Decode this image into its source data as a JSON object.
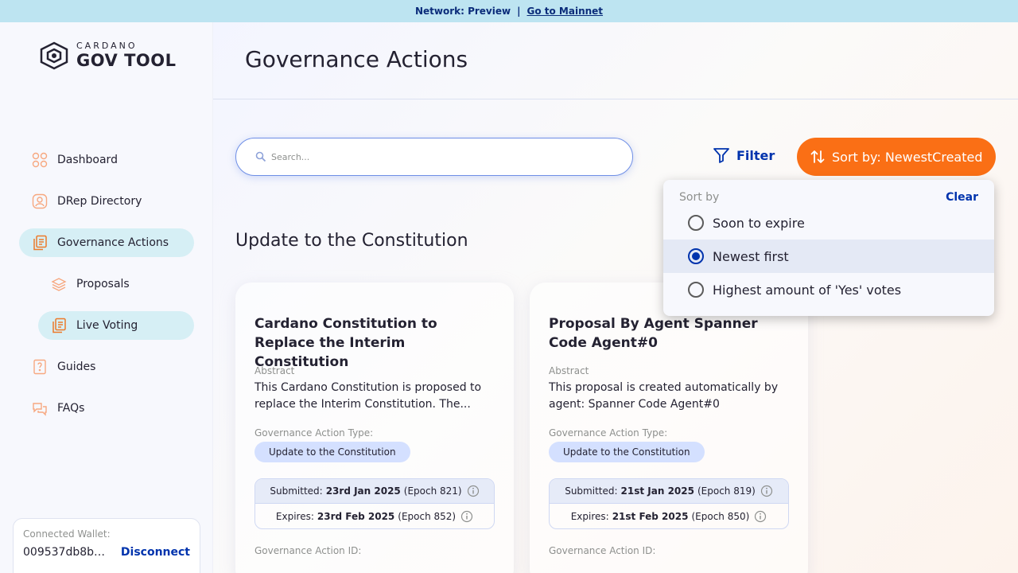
{
  "topbar": {
    "network": "Network: Preview",
    "separator": "|",
    "link": "Go to Mainnet"
  },
  "logo": {
    "small": "CARDANO",
    "big": "GOV TOOL"
  },
  "sidebar": {
    "items": [
      {
        "label": "Dashboard",
        "icon": "dashboard-icon"
      },
      {
        "label": "DRep Directory",
        "icon": "drep-directory-icon"
      },
      {
        "label": "Governance Actions",
        "icon": "governance-actions-icon"
      },
      {
        "label": "Proposals",
        "icon": "proposals-icon"
      },
      {
        "label": "Live Voting",
        "icon": "live-voting-icon"
      },
      {
        "label": "Guides",
        "icon": "guides-icon"
      },
      {
        "label": "FAQs",
        "icon": "faqs-icon"
      }
    ],
    "wallet": {
      "label": "Connected Wallet:",
      "address": "009537db8bb...",
      "disconnect": "Disconnect"
    }
  },
  "header": {
    "title": "Governance Actions"
  },
  "search": {
    "placeholder": "Search..."
  },
  "toolbar": {
    "filter_label": "Filter",
    "sort_label": "Sort by: NewestCreated"
  },
  "section": {
    "title": "Update to the Constitution"
  },
  "cards": [
    {
      "title": "Cardano Constitution to Replace the Interim Constitution",
      "abstract_label": "Abstract",
      "abstract": "This Cardano Constitution is proposed to replace the Interim Constitution. The...",
      "type_label": "Governance Action Type:",
      "type": "Update to the Constitution",
      "submitted_prefix": "Submitted:",
      "submitted_date": "23rd Jan 2025",
      "submitted_epoch": "(Epoch 821)",
      "expires_prefix": "Expires:",
      "expires_date": "23rd Feb 2025",
      "expires_epoch": "(Epoch 852)",
      "id_label": "Governance Action ID:"
    },
    {
      "title": "Proposal By Agent Spanner Code Agent#0",
      "abstract_label": "Abstract",
      "abstract": "This proposal is created automatically by agent: Spanner Code Agent#0",
      "type_label": "Governance Action Type:",
      "type": "Update to the Constitution",
      "submitted_prefix": "Submitted:",
      "submitted_date": "21st Jan 2025",
      "submitted_epoch": "(Epoch 819)",
      "expires_prefix": "Expires:",
      "expires_date": "21st Feb 2025",
      "expires_epoch": "(Epoch 850)",
      "id_label": "Governance Action ID:"
    }
  ],
  "sort_menu": {
    "title": "Sort by",
    "clear": "Clear",
    "options": [
      {
        "label": "Soon to expire",
        "selected": false
      },
      {
        "label": "Newest first",
        "selected": true
      },
      {
        "label": "Highest amount of 'Yes' votes",
        "selected": false
      }
    ]
  },
  "colors": {
    "accent": "#fa6f15",
    "primary": "#0033ad",
    "active_nav": "#d6eff5",
    "topbar": "#bde4f1"
  }
}
